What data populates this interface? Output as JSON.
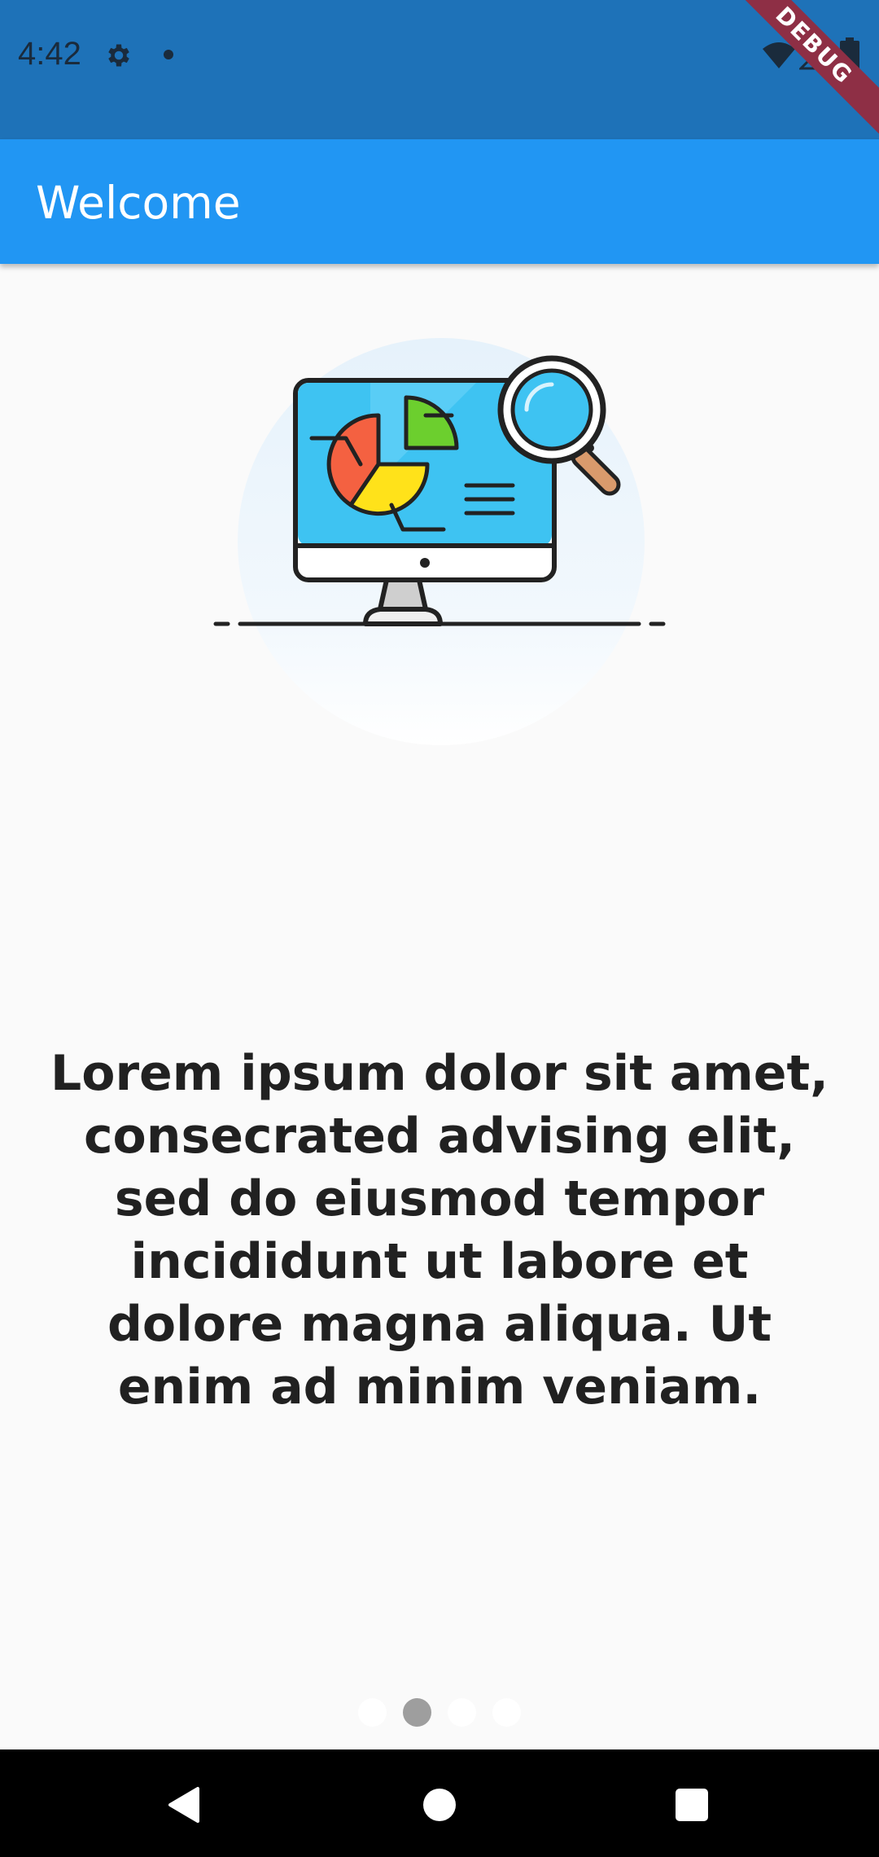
{
  "status_bar": {
    "time": "4:42",
    "icons": [
      "gear-icon",
      "notification-dot-icon",
      "wifi-icon",
      "signal-icon",
      "battery-icon"
    ],
    "debug_label": "DEBUG"
  },
  "app_bar": {
    "title": "Welcome"
  },
  "illustration": {
    "icon": "analytics-monitor-illustration"
  },
  "content": {
    "body": "Lorem ipsum dolor sit amet, consecrated advising elit, sed do eiusmod tempor incididunt ut labore et dolore magna aliqua. Ut enim ad minim veniam."
  },
  "page_indicator": {
    "total": 4,
    "active_index": 1
  },
  "nav_bar": {
    "buttons": [
      "back-icon",
      "home-icon",
      "recents-icon"
    ]
  },
  "colors": {
    "status_bar": "#1e72b8",
    "app_bar": "#2196f3",
    "background": "#fafafa",
    "text": "#212121",
    "dot_active": "#9e9e9e",
    "dot_inactive": "#ffffff"
  }
}
